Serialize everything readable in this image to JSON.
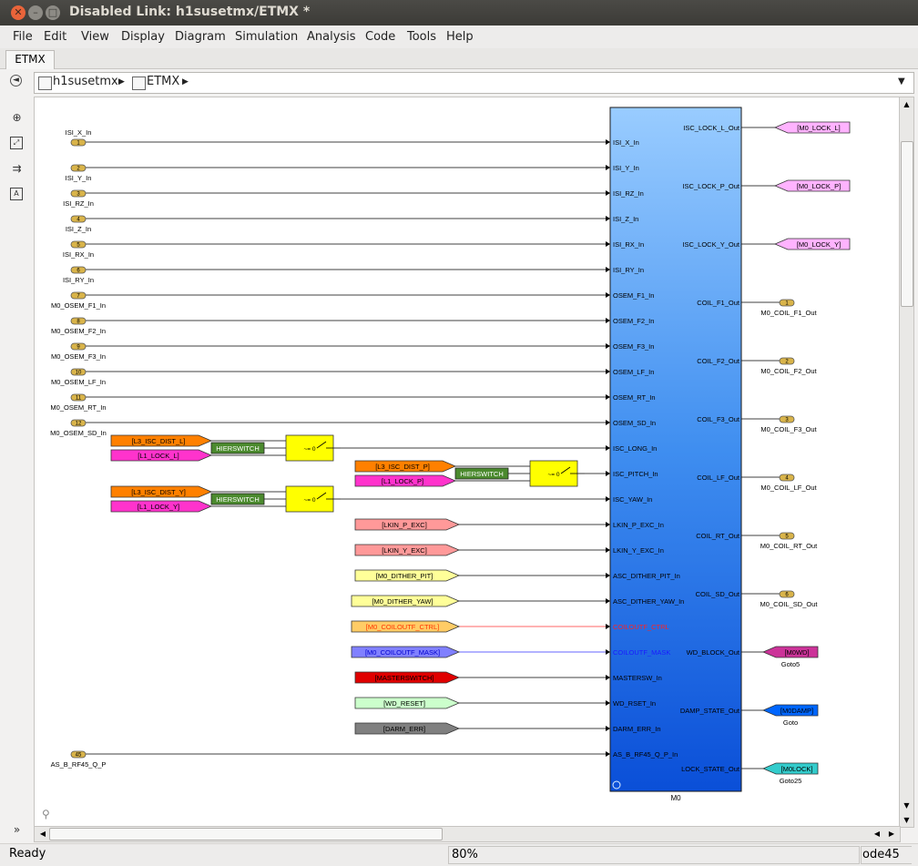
{
  "window": {
    "title": "Disabled Link: h1susetmx/ETMX *"
  },
  "menu": [
    "File",
    "Edit",
    "View",
    "Display",
    "Diagram",
    "Simulation",
    "Analysis",
    "Code",
    "Tools",
    "Help"
  ],
  "tab": {
    "label": "ETMX"
  },
  "breadcrumb": [
    "h1susetmx",
    "ETMX"
  ],
  "left_inports": [
    {
      "num": "1",
      "label": "ISI_X_In",
      "label_above": true
    },
    {
      "num": "2",
      "label": "ISI_Y_In"
    },
    {
      "num": "3",
      "label": "ISI_RZ_In"
    },
    {
      "num": "4",
      "label": "ISI_Z_In"
    },
    {
      "num": "5",
      "label": "ISI_RX_In"
    },
    {
      "num": "6",
      "label": "ISI_RY_In"
    },
    {
      "num": "7",
      "label": "M0_OSEM_F1_In"
    },
    {
      "num": "8",
      "label": "M0_OSEM_F2_In"
    },
    {
      "num": "9",
      "label": "M0_OSEM_F3_In"
    },
    {
      "num": "10",
      "label": "M0_OSEM_LF_In"
    },
    {
      "num": "11",
      "label": "M0_OSEM_RT_In"
    },
    {
      "num": "12",
      "label": "M0_OSEM_SD_In"
    }
  ],
  "extra_inport": {
    "num": "45",
    "label": "AS_B_RF45_Q_P"
  },
  "block": {
    "name": "M0",
    "inputs": [
      "ISI_X_In",
      "ISI_Y_In",
      "ISI_RZ_In",
      "ISI_Z_In",
      "ISI_RX_In",
      "ISI_RY_In",
      "OSEM_F1_In",
      "OSEM_F2_In",
      "OSEM_F3_In",
      "OSEM_LF_In",
      "OSEM_RT_In",
      "OSEM_SD_In",
      "ISC_LONG_In",
      "ISC_PITCH_In",
      "ISC_YAW_In",
      "LKIN_P_EXC_In",
      "LKIN_Y_EXC_In",
      "ASC_DITHER_PIT_In",
      "ASC_DITHER_YAW_In",
      "COILOUTF_CTRL",
      "COILOUTF_MASK",
      "MASTERSW_In",
      "WD_RSET_In",
      "DARM_ERR_In",
      "AS_B_RF45_Q_P_In"
    ],
    "outputs": [
      "ISC_LOCK_L_Out",
      "ISC_LOCK_P_Out",
      "ISC_LOCK_Y_Out",
      "COIL_F1_Out",
      "COIL_F2_Out",
      "COIL_F3_Out",
      "COIL_LF_Out",
      "COIL_RT_Out",
      "COIL_SD_Out",
      "WD_BLOCK_Out",
      "DAMP_STATE_Out",
      "LOCK_STATE_Out"
    ]
  },
  "from_tags": [
    {
      "label": "[L3_ISC_DIST_L]",
      "color": "#ff8000"
    },
    {
      "label": "[L1_LOCK_L]",
      "color": "#ff33cc"
    },
    {
      "label": "[L3_ISC_DIST_P]",
      "color": "#ff8000"
    },
    {
      "label": "[L1_LOCK_P]",
      "color": "#ff33cc"
    },
    {
      "label": "[L3_ISC_DIST_Y]",
      "color": "#ff8000"
    },
    {
      "label": "[L1_LOCK_Y]",
      "color": "#ff33cc"
    },
    {
      "label": "[LKIN_P_EXC]",
      "color": "#ff9999"
    },
    {
      "label": "[LKIN_Y_EXC]",
      "color": "#ff9999"
    },
    {
      "label": "[M0_DITHER_PIT]",
      "color": "#ffff99"
    },
    {
      "label": "[M0_DITHER_YAW]",
      "color": "#ffff99"
    },
    {
      "label": "[M0_COILOUTF_CTRL]",
      "color": "#ffcc66"
    },
    {
      "label": "[M0_COILOUTF_MASK]",
      "color": "#8080ff"
    },
    {
      "label": "[MASTERSWITCH]",
      "color": "#e00000"
    },
    {
      "label": "[WD_RESET]",
      "color": "#ccffcc"
    },
    {
      "label": "[DARM_ERR]",
      "color": "#808080"
    }
  ],
  "hierswitch_label": "HIERSWITCH",
  "switch_text": "~= 0",
  "goto_tags": [
    {
      "label": "[M0_LOCK_L]",
      "color": "#ffb3ff"
    },
    {
      "label": "[M0_LOCK_P]",
      "color": "#ffb3ff"
    },
    {
      "label": "[M0_LOCK_Y]",
      "color": "#ffb3ff"
    },
    {
      "label": "[M0WD]",
      "color": "#cc3399",
      "name": "Goto5"
    },
    {
      "label": "[M0DAMP]",
      "color": "#0066ff",
      "name": "Goto"
    },
    {
      "label": "[M0LOCK]",
      "color": "#33cccc",
      "name": "Goto25"
    }
  ],
  "out_ports": [
    {
      "num": "1",
      "label": "M0_COIL_F1_Out"
    },
    {
      "num": "2",
      "label": "M0_COIL_F2_Out"
    },
    {
      "num": "3",
      "label": "M0_COIL_F3_Out"
    },
    {
      "num": "4",
      "label": "M0_COIL_LF_Out"
    },
    {
      "num": "5",
      "label": "M0_COIL_RT_Out"
    },
    {
      "num": "6",
      "label": "M0_COIL_SD_Out"
    }
  ],
  "status": {
    "left": "Ready",
    "zoom": "80%",
    "solver": "ode45"
  }
}
